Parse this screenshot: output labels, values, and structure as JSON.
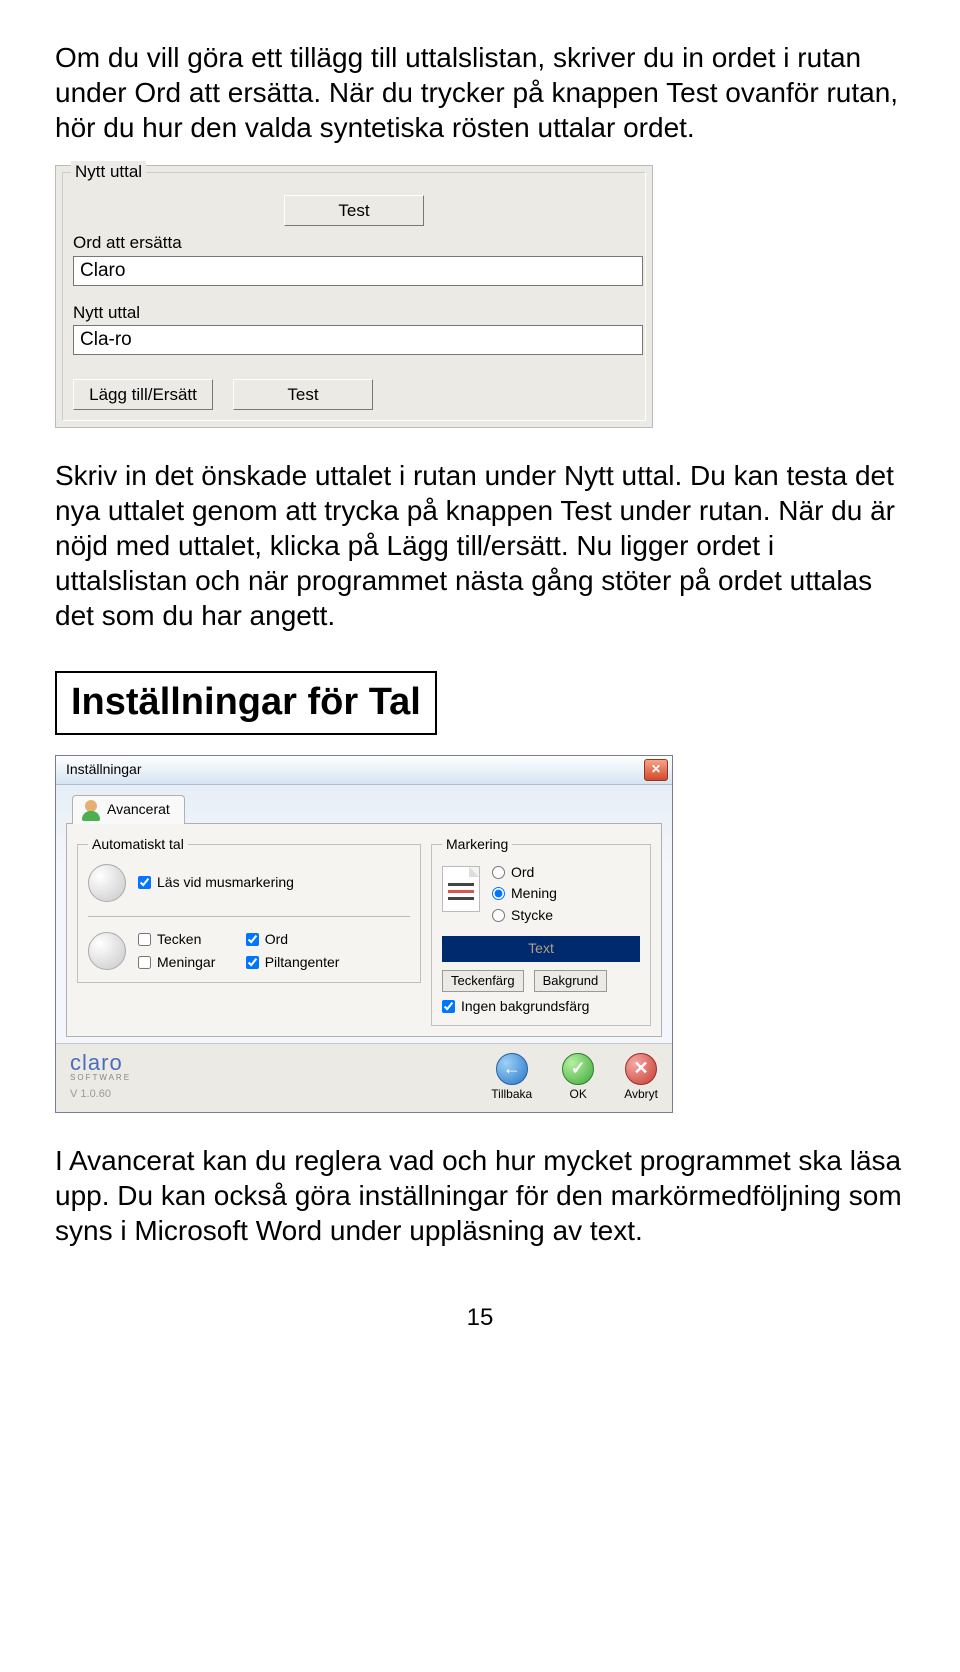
{
  "para1": "Om du vill göra ett tillägg till uttalslistan, skriver du in ordet i rutan under Ord att ersätta. När du trycker på knappen Test ovanför rutan, hör du hur den valda syntetiska rösten uttalar ordet.",
  "para2": "Skriv in det önskade uttalet i rutan under Nytt uttal. Du kan testa det nya uttalet genom att trycka på knappen Test under rutan. När du är nöjd med uttalet, klicka på Lägg till/ersätt. Nu ligger ordet i uttalslistan och när programmet nästa gång stöter på ordet uttalas det som du har angett.",
  "heading": "Inställningar för Tal",
  "para3": "I Avancerat kan du reglera vad och hur mycket programmet ska läsa upp. Du kan också göra inställningar för den markörmedföljning som syns i Microsoft Word under uppläsning av text.",
  "page_number": "15",
  "shot1": {
    "legend": "Nytt uttal",
    "label_replace": "Ord att ersätta",
    "input_replace": "Claro",
    "label_new": "Nytt uttal",
    "input_new": "Cla-ro",
    "btn_test": "Test",
    "btn_add": "Lägg till/Ersätt"
  },
  "shot2": {
    "title": "Inställningar",
    "tab": "Avancerat",
    "group_auto": "Automatiskt tal",
    "chk_mouse": "Läs vid musmarkering",
    "chk_tecken": "Tecken",
    "chk_ord": "Ord",
    "chk_meningar": "Meningar",
    "chk_pil": "Piltangenter",
    "group_mark": "Markering",
    "rad_ord": "Ord",
    "rad_mening": "Mening",
    "rad_stycke": "Stycke",
    "text_sample": "Text",
    "btn_fg": "Teckenfärg",
    "btn_bg": "Bakgrund",
    "chk_nobg": "Ingen bakgrundsfärg",
    "logo": "claro",
    "logo_sw": "SOFTWARE",
    "version": "V 1.0.60",
    "btn_back": "Tillbaka",
    "btn_ok": "OK",
    "btn_cancel": "Avbryt"
  }
}
